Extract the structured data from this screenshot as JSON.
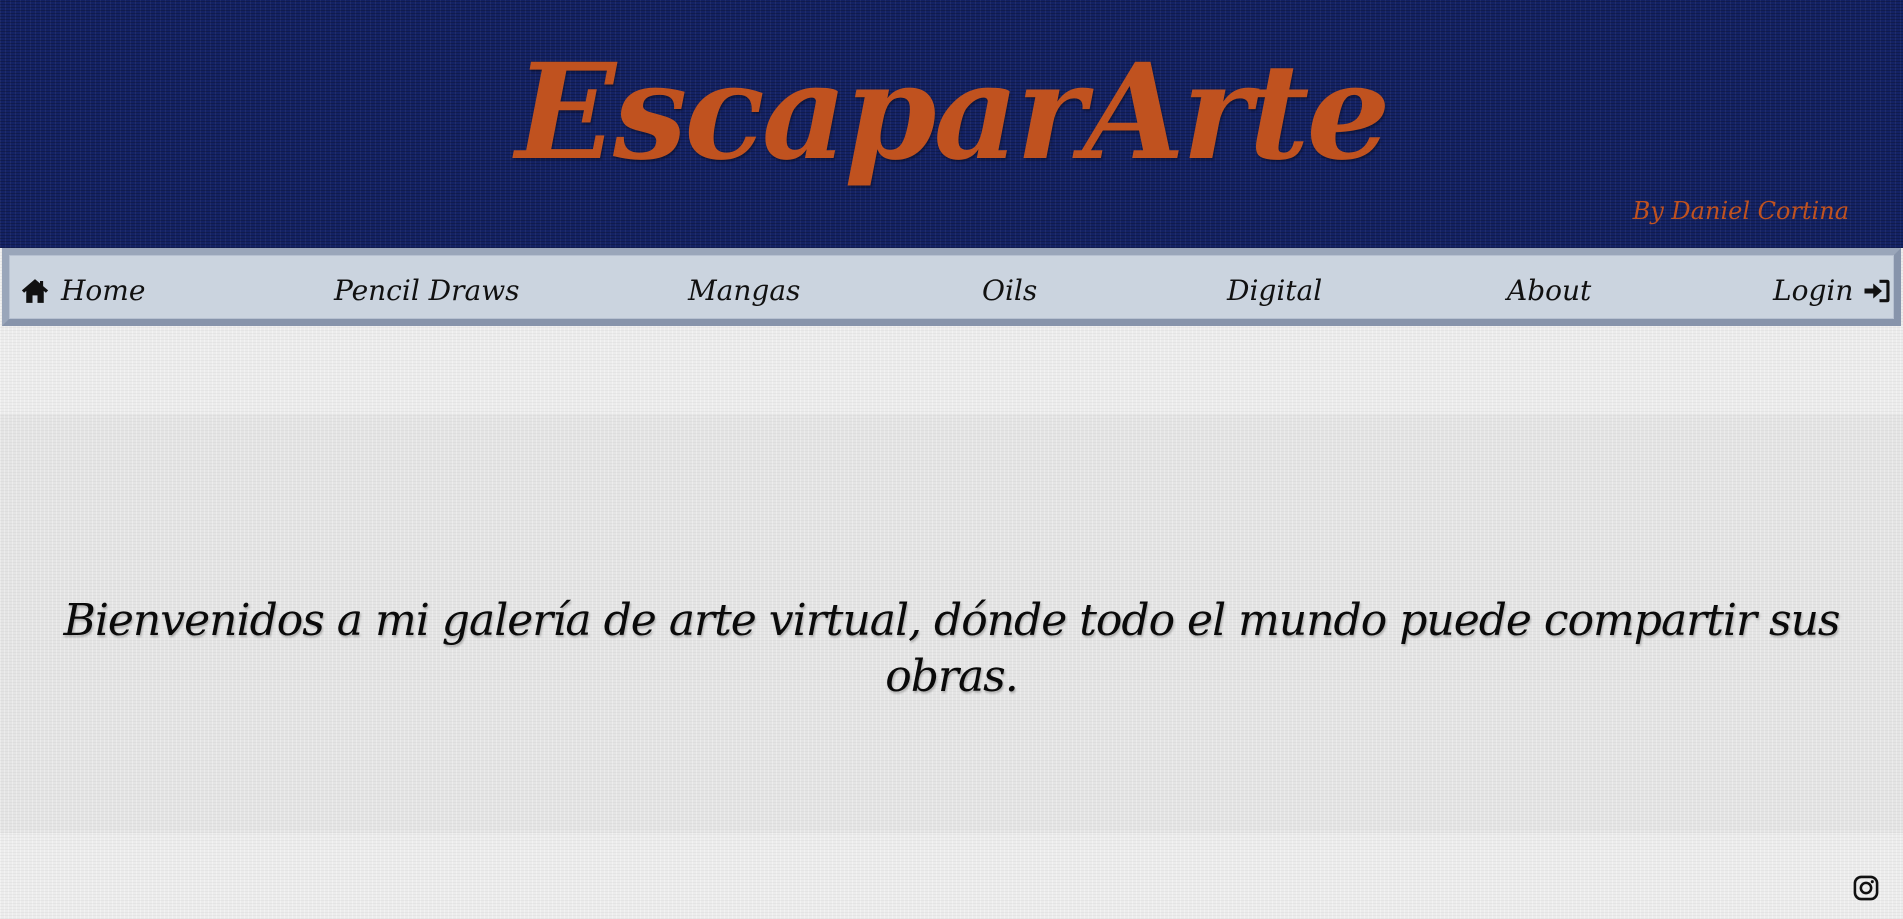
{
  "header": {
    "title": "EscaparArte",
    "byline": "By Daniel Cortina"
  },
  "nav": {
    "items": [
      {
        "label": "Home",
        "icon": "home-icon"
      },
      {
        "label": "Pencil Draws"
      },
      {
        "label": "Mangas"
      },
      {
        "label": "Oils"
      },
      {
        "label": "Digital"
      },
      {
        "label": "About"
      },
      {
        "label": "Login",
        "icon": "sign-in-icon"
      }
    ]
  },
  "main": {
    "welcome_text": "Bienvenidos a mi galería de arte virtual, dónde todo el mundo puede compartir sus obras."
  },
  "footer": {
    "social_icon": "instagram-icon"
  },
  "colors": {
    "header_background": "#142264",
    "title_accent": "#c0521f",
    "nav_background": "#cbd4df",
    "nav_border": "#8794ab",
    "page_background": "#ececec"
  }
}
